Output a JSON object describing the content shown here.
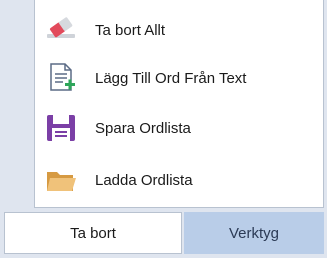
{
  "menu": {
    "items": [
      {
        "label": "Ta bort Allt",
        "icon": "eraser-icon"
      },
      {
        "label": "Lägg Till Ord Från Text",
        "icon": "document-add-icon"
      },
      {
        "label": "Spara Ordlista",
        "icon": "floppy-disk-icon"
      },
      {
        "label": "Ladda Ordlista",
        "icon": "folder-icon"
      }
    ]
  },
  "tabs": {
    "delete_label": "Ta bort",
    "tools_label": "Verktyg",
    "active": "Verktyg"
  },
  "colors": {
    "active_tab": "#b9cde8",
    "eraser_red": "#e24a5b",
    "floppy_purple": "#7b3fa6",
    "folder_tan": "#e8b567",
    "add_green": "#2ea65a"
  }
}
